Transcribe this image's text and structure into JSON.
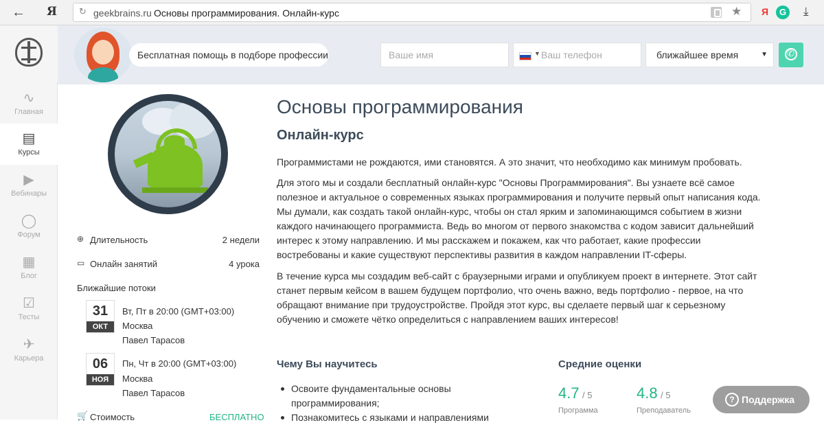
{
  "browser": {
    "back_glyph": "←",
    "yandex_glyph": "Я",
    "reload_glyph": "↻",
    "url_domain": "geekbrains.ru",
    "url_title": "Основы программирования. Онлайн-курс",
    "star_glyph": "★",
    "ext_yandex": "Я",
    "ext_grammarly": "G",
    "download_glyph": "⤓"
  },
  "sidebar": {
    "items": [
      {
        "label": "Главная",
        "icon": "pulse-icon",
        "glyph": "∿"
      },
      {
        "label": "Курсы",
        "icon": "book-icon",
        "glyph": "▤"
      },
      {
        "label": "Вебинары",
        "icon": "play-icon",
        "glyph": "▶"
      },
      {
        "label": "Форум",
        "icon": "chat-icon",
        "glyph": "◯"
      },
      {
        "label": "Блог",
        "icon": "news-icon",
        "glyph": "▦"
      },
      {
        "label": "Тесты",
        "icon": "check-icon",
        "glyph": "☑"
      },
      {
        "label": "Карьера",
        "icon": "rocket-icon",
        "glyph": "✈"
      }
    ]
  },
  "header": {
    "help_text": "Бесплатная помощь в подборе профессии",
    "name_placeholder": "Ваше имя",
    "phone_placeholder": "Ваш телефон",
    "time_value": "ближайшее время",
    "caret": "▼",
    "flag_caret": "▼"
  },
  "info": {
    "duration_label": "Длительность",
    "duration_value": "2 недели",
    "duration_glyph": "⊕",
    "lessons_label": "Онлайн занятий",
    "lessons_value": "4 урока",
    "lessons_glyph": "▭",
    "streams_title": "Ближайшие потоки",
    "streams": [
      {
        "day": "31",
        "month": "ОКТ",
        "schedule": "Вт, Пт в 20:00 (GMT+03:00)",
        "city": "Москва",
        "teacher": "Павел Тарасов"
      },
      {
        "day": "06",
        "month": "НОЯ",
        "schedule": "Пн, Чт в 20:00 (GMT+03:00)",
        "city": "Москва",
        "teacher": "Павел Тарасов"
      }
    ],
    "cost_label": "Стоимость",
    "cost_value": "БЕСПЛАТНО",
    "cost_glyph": "🛒"
  },
  "main": {
    "title": "Основы программирования",
    "subtitle": "Онлайн-курс",
    "paragraphs": [
      "Программистами не рождаются, ими становятся. А это значит, что необходимо как минимум пробовать.",
      "Для этого мы и создали бесплатный онлайн-курс \"Основы Программирования\". Вы узнаете всё самое полезное и актуальное о современных языках программирования и получите первый опыт написания кода. Мы думали, как создать такой онлайн-курс, чтобы он стал ярким и запоминающимся событием в жизни каждого начинающего программиста. Ведь во многом от первого знакомства с кодом зависит дальнейший интерес к этому направлению. И мы расскажем и покажем, как что работает, какие профессии востребованы и какие существуют перспективы развития в каждом направлении IT-сферы.",
      "В течение курса мы создадим веб-сайт с браузерными играми и опубликуем проект в интернете. Этот сайт станет первым кейсом в вашем будущем портфолио, что очень важно, ведь портфолио - первое, на что обращают внимание при трудоустройстве. Пройдя этот курс, вы сделаете первый шаг к серьезному обучению и сможете чётко определиться с направлением ваших интересов!"
    ],
    "learn_title": "Чему Вы научитесь",
    "learn_items": [
      "Освоите фундаментальные основы программирования;",
      "Познакомитесь с языками и направлениями"
    ],
    "ratings_title": "Средние оценки",
    "ratings": [
      {
        "value": "4.7",
        "max": "/ 5",
        "label": "Программа"
      },
      {
        "value": "4.8",
        "max": "/ 5",
        "label": "Преподаватель"
      }
    ]
  },
  "support": {
    "label": "Поддержка",
    "glyph": "?"
  }
}
